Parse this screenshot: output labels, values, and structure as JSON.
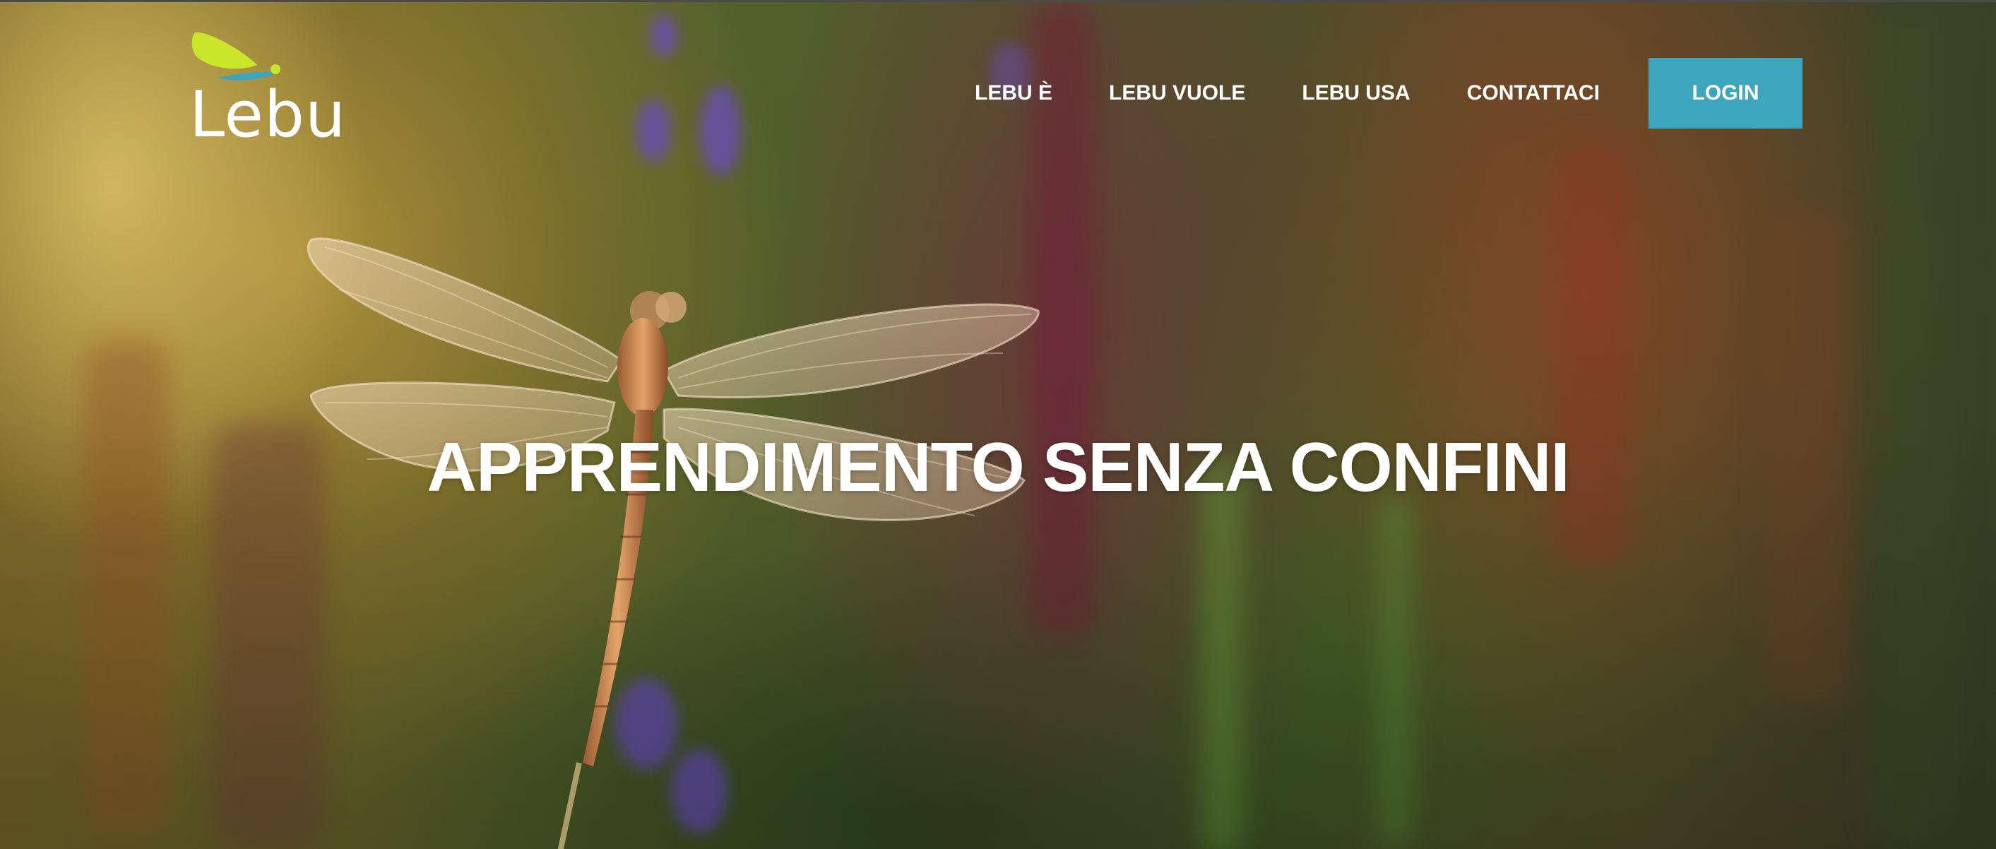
{
  "brand": {
    "name": "Lebu",
    "logo_icon": "dragonfly-logo-icon",
    "colors": {
      "logo_wing": "#c9e62a",
      "logo_body": "#3ea6bc"
    }
  },
  "nav": {
    "items": [
      {
        "label": "LEBU È"
      },
      {
        "label": "LEBU VUOLE"
      },
      {
        "label": "LEBU USA"
      },
      {
        "label": "CONTATTACI"
      }
    ],
    "login_label": "LOGIN",
    "login_color": "#3ea6bc"
  },
  "hero": {
    "headline": "APPRENDIMENTO SENZA CONFINI",
    "background_image": "dragonfly-on-grass-photo"
  }
}
